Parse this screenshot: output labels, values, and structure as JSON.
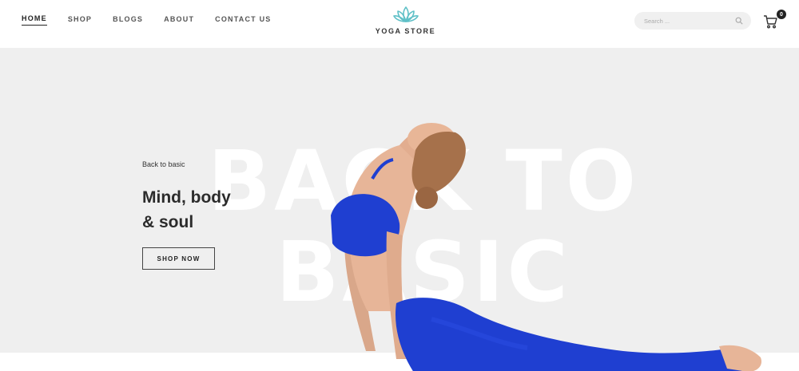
{
  "nav": {
    "items": [
      {
        "label": "HOME",
        "active": true
      },
      {
        "label": "SHOP",
        "active": false
      },
      {
        "label": "BLOGS",
        "active": false
      },
      {
        "label": "ABOUT",
        "active": false
      },
      {
        "label": "CONTACT US",
        "active": false
      }
    ]
  },
  "brand": {
    "name": "YOGA STORE",
    "logo_icon": "lotus-icon",
    "logo_color": "#5fc0c7"
  },
  "search": {
    "placeholder": "Search ...",
    "value": ""
  },
  "cart": {
    "count": "0"
  },
  "hero": {
    "background_text_line1": "BACK TO",
    "background_text_line2": "BASIC",
    "subtitle": "Back to basic",
    "title_line1": "Mind, body",
    "title_line2": "& soul",
    "button_label": "SHOP NOW",
    "accent_color": "#1f3fd1"
  }
}
